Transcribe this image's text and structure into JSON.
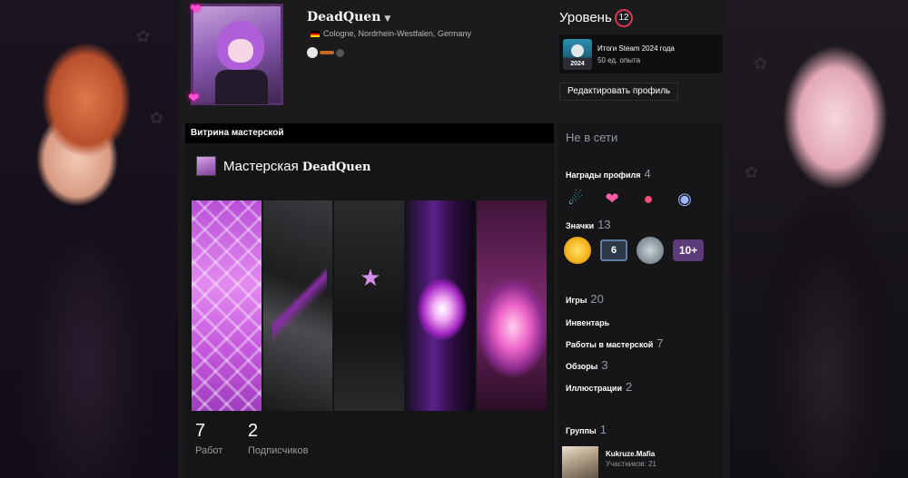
{
  "profile": {
    "name": "DeadQuen",
    "location": "Cologne, Nordrhein-Westfalen, Germany"
  },
  "level": {
    "label": "Уровень",
    "value": "12"
  },
  "year_review": {
    "title": "Итоги Steam 2024 года",
    "xp": "50 ед. опыта",
    "icon_year": "2024"
  },
  "edit_profile_button": "Редактировать профиль",
  "showcase": {
    "header": "Витрина мастерской",
    "title_prefix": "Мастерская",
    "title_name": "DeadQuen",
    "stats": [
      {
        "value": "7",
        "label": "Работ"
      },
      {
        "value": "2",
        "label": "Подписчиков"
      }
    ]
  },
  "sidebar": {
    "status": "Не в сети",
    "awards": {
      "label": "Награды профиля",
      "count": "4",
      "icons": [
        "comet-award-icon",
        "heart-award-icon",
        "bird-award-icon",
        "tiger-award-icon"
      ]
    },
    "badges": {
      "label": "Значки",
      "count": "13",
      "items": [
        "",
        "6",
        "",
        "10+"
      ]
    },
    "links": [
      {
        "label": "Игры",
        "count": "20"
      },
      {
        "label": "Инвентарь",
        "count": ""
      },
      {
        "label": "Работы в мастерской",
        "count": "7"
      },
      {
        "label": "Обзоры",
        "count": "3"
      },
      {
        "label": "Иллюстрации",
        "count": "2"
      }
    ],
    "groups": {
      "label": "Группы",
      "count": "1",
      "item": {
        "name": "Kukruze.Mafia",
        "members": "Участников: 21"
      }
    }
  }
}
